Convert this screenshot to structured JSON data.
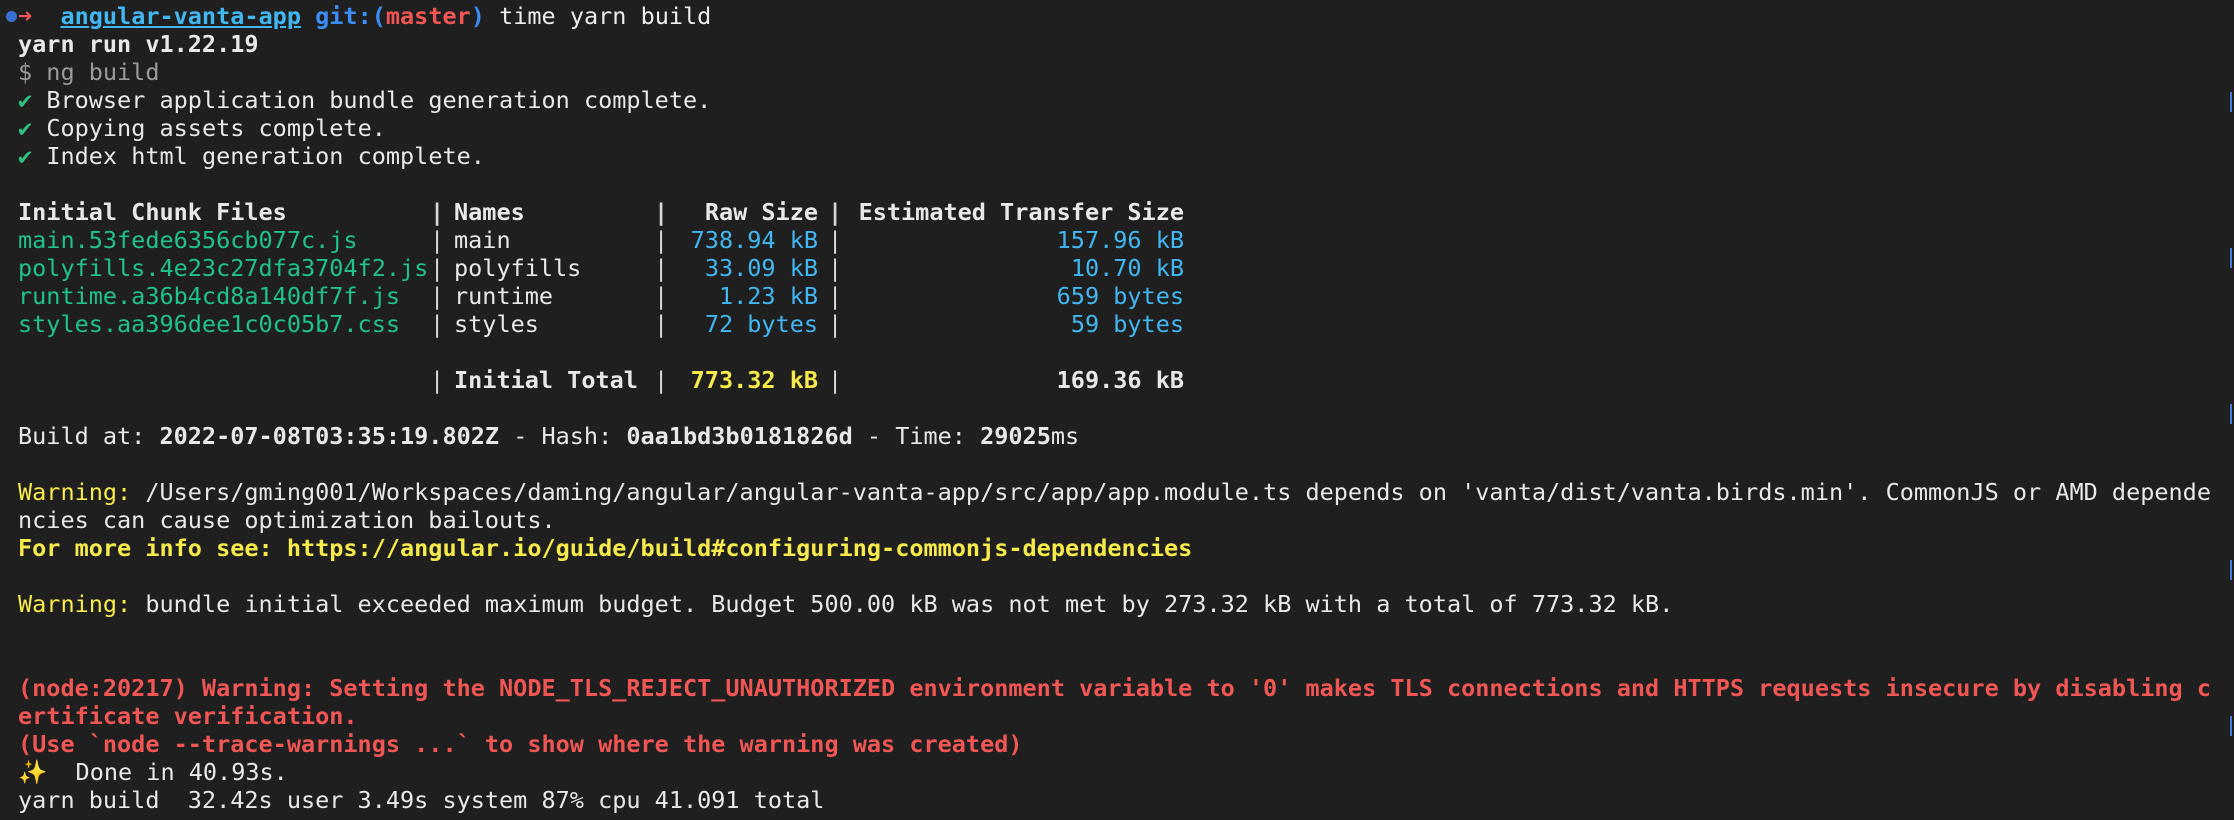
{
  "prompt": {
    "arrow": "➜",
    "dir": "angular-vanta-app",
    "git_prefix": "git:(",
    "branch": "master",
    "git_suffix": ")",
    "command": "time yarn build"
  },
  "header_lines": {
    "yarn_run": "yarn run v1.22.19",
    "ng_build": "$ ng build"
  },
  "checks": [
    {
      "mark": "✔",
      "text": "Browser application bundle generation complete."
    },
    {
      "mark": "✔",
      "text": "Copying assets complete."
    },
    {
      "mark": "✔",
      "text": "Index html generation complete."
    }
  ],
  "table": {
    "headers": [
      "Initial Chunk Files",
      "Names",
      "Raw Size",
      "Estimated Transfer Size"
    ],
    "rows": [
      {
        "file": "main.53fede6356cb077c.js",
        "name": "main",
        "raw": "738.94 kB",
        "transfer": "157.96 kB"
      },
      {
        "file": "polyfills.4e23c27dfa3704f2.js",
        "name": "polyfills",
        "raw": "33.09 kB",
        "transfer": "10.70 kB"
      },
      {
        "file": "runtime.a36b4cd8a140df7f.js",
        "name": "runtime",
        "raw": "1.23 kB",
        "transfer": "659 bytes"
      },
      {
        "file": "styles.aa396dee1c0c05b7.css",
        "name": "styles",
        "raw": "72 bytes",
        "transfer": "59 bytes"
      }
    ],
    "total_label": "Initial Total",
    "total_raw": "773.32 kB",
    "total_transfer": "169.36 kB",
    "separator": "|"
  },
  "build_info": {
    "build_at_label": "Build at: ",
    "build_at": "2022-07-08T03:35:19.802Z",
    "hash_label": " - Hash: ",
    "hash": "0aa1bd3b0181826d",
    "time_label": " - Time: ",
    "time": "29025",
    "time_unit": "ms"
  },
  "warning1": {
    "label": "Warning:",
    "text": " /Users/gming001/Workspaces/daming/angular/angular-vanta-app/src/app/app.module.ts depends on 'vanta/dist/vanta.birds.min'. CommonJS or AMD dependencies can cause optimization bailouts.",
    "more_info": "For more info see: https://angular.io/guide/build#configuring-commonjs-dependencies"
  },
  "warning2": {
    "label": "Warning:",
    "text": " bundle initial exceeded maximum budget. Budget 500.00 kB was not met by 273.32 kB with a total of 773.32 kB."
  },
  "node_warning": {
    "line1": "(node:20217) Warning: Setting the NODE_TLS_REJECT_UNAUTHORIZED environment variable to '0' makes TLS connections and HTTPS requests insecure by disabling certificate verification.",
    "line2": "(Use `node --trace-warnings ...` to show where the warning was created)"
  },
  "done": {
    "icon": "✨",
    "text": "  Done in 40.93s."
  },
  "timing": "yarn build  32.42s user 3.49s system 87% cpu 41.091 total",
  "colors": {
    "background": "#1f1f1f",
    "cyan": "#41b7f2",
    "green": "#2ec27e",
    "red": "#f05654",
    "yellow": "#f6eb4b"
  }
}
